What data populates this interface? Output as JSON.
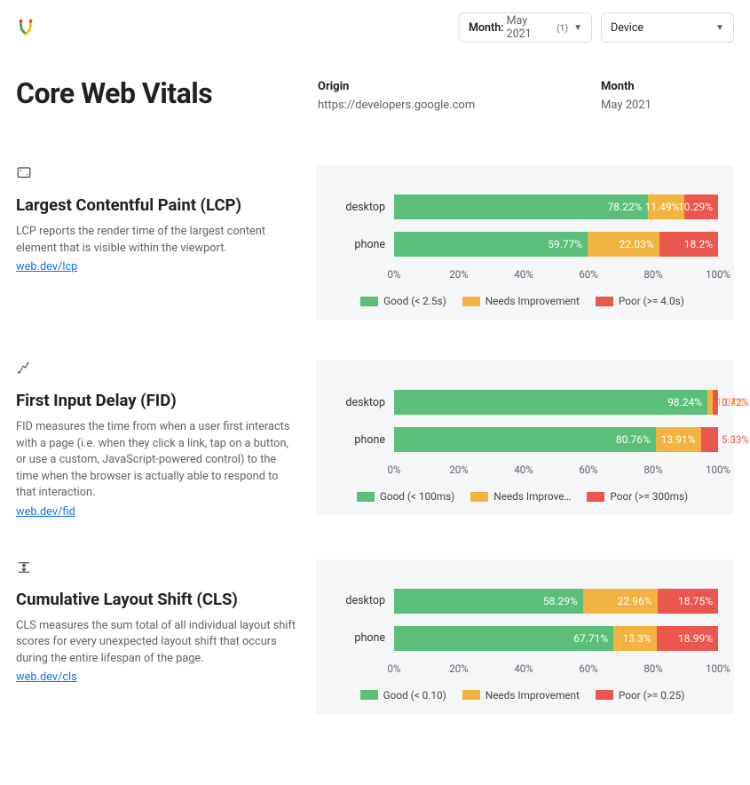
{
  "topbar": {
    "month_label": "Month:",
    "month_value": "May 2021",
    "month_count": "(1)",
    "device_label": "Device"
  },
  "header": {
    "title": "Core Web Vitals",
    "origin_label": "Origin",
    "origin_value": "https://developers.google.com",
    "month_label": "Month",
    "month_value": "May 2021"
  },
  "metrics": [
    {
      "id": "lcp",
      "title": "Largest Contentful Paint (LCP)",
      "desc": "LCP reports the render time of the largest content element that is visible within the viewport.",
      "link": "web.dev/lcp",
      "legend": {
        "good": "Good (< 2.5s)",
        "ni": "Needs Improvement",
        "poor": "Poor (>= 4.0s)"
      }
    },
    {
      "id": "fid",
      "title": "First Input Delay (FID)",
      "desc": "FID measures the time from when a user first interacts with a page (i.e. when they click a link, tap on a button, or use a custom, JavaScript-powered control) to the time when the browser is actually able to respond to that interaction.",
      "link": "web.dev/fid",
      "legend": {
        "good": "Good (< 100ms)",
        "ni": "Needs Improve…",
        "poor": "Poor (>= 300ms)"
      }
    },
    {
      "id": "cls",
      "title": "Cumulative Layout Shift (CLS)",
      "desc": "CLS measures the sum total of all individual layout shift scores for every unexpected layout shift that occurs during the entire lifespan of the page.",
      "link": "web.dev/cls",
      "legend": {
        "good": "Good (< 0.10)",
        "ni": "Needs Improvement",
        "poor": "Poor (>= 0.25)"
      }
    }
  ],
  "axis_ticks": [
    "0%",
    "20%",
    "40%",
    "60%",
    "80%",
    "100%"
  ],
  "chart_data": [
    {
      "type": "bar",
      "metric": "lcp",
      "title": "Largest Contentful Paint (LCP)",
      "categories": [
        "desktop",
        "phone"
      ],
      "series": [
        {
          "name": "Good",
          "values": [
            78.22,
            59.77
          ]
        },
        {
          "name": "Needs Improvement",
          "values": [
            11.49,
            22.03
          ]
        },
        {
          "name": "Poor",
          "values": [
            10.29,
            18.2
          ]
        }
      ],
      "labels": {
        "desktop": {
          "good": "78.22%",
          "ni": "11.49%",
          "poor": "10.29%"
        },
        "phone": {
          "good": "59.77%",
          "ni": "22.03%",
          "poor": "18.2%"
        }
      },
      "xlim": [
        0,
        100
      ],
      "xlabel": "",
      "ylabel": ""
    },
    {
      "type": "bar",
      "metric": "fid",
      "title": "First Input Delay (FID)",
      "categories": [
        "desktop",
        "phone"
      ],
      "series": [
        {
          "name": "Good",
          "values": [
            98.24,
            80.76
          ]
        },
        {
          "name": "Needs Improvement",
          "values": [
            1.04,
            13.91
          ]
        },
        {
          "name": "Poor",
          "values": [
            0.72,
            5.33
          ]
        }
      ],
      "labels": {
        "desktop": {
          "good": "98.24%",
          "ni": "1.04%",
          "poor": "0.72%"
        },
        "phone": {
          "good": "80.76%",
          "ni": "13.91%",
          "poor": "5.33%"
        }
      },
      "xlim": [
        0,
        100
      ],
      "xlabel": "",
      "ylabel": ""
    },
    {
      "type": "bar",
      "metric": "cls",
      "title": "Cumulative Layout Shift (CLS)",
      "categories": [
        "desktop",
        "phone"
      ],
      "series": [
        {
          "name": "Good",
          "values": [
            58.29,
            67.71
          ]
        },
        {
          "name": "Needs Improvement",
          "values": [
            22.96,
            13.3
          ]
        },
        {
          "name": "Poor",
          "values": [
            18.75,
            18.99
          ]
        }
      ],
      "labels": {
        "desktop": {
          "good": "58.29%",
          "ni": "22.96%",
          "poor": "18.75%"
        },
        "phone": {
          "good": "67.71%",
          "ni": "13.3%",
          "poor": "18.99%"
        }
      },
      "xlim": [
        0,
        100
      ],
      "xlabel": "",
      "ylabel": ""
    }
  ]
}
